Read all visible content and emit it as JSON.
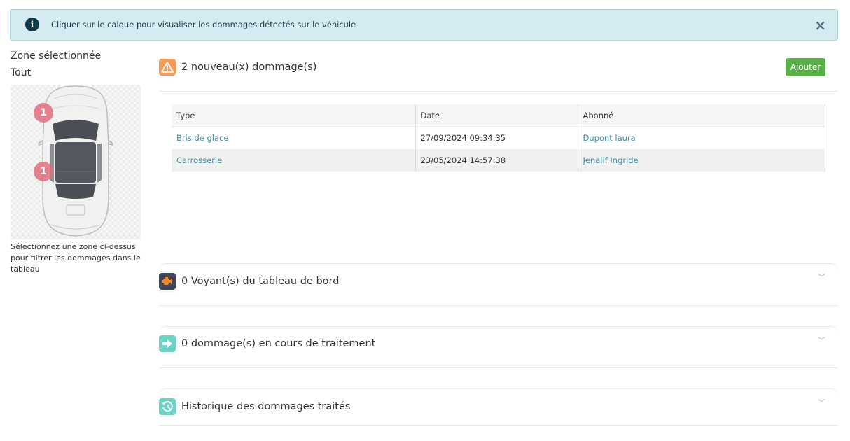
{
  "alert": {
    "message": "Cliquer sur le calque pour visualiser les dommages détectés sur le véhicule",
    "info_glyph": "i",
    "close_glyph": "×"
  },
  "sidebar": {
    "zone_title": "Zone sélectionnée",
    "zone_value": "Tout",
    "markers": [
      "1",
      "1"
    ],
    "hint": "Sélectionnez une zone ci-dessus pour filtrer les dommages dans le tableau"
  },
  "new_damages": {
    "title": "2 nouveau(x) dommage(s)",
    "add_label": "Ajouter",
    "columns": [
      "Type",
      "Date",
      "Abonné"
    ],
    "rows": [
      {
        "type": "Bris de glace",
        "date": "27/09/2024 09:34:35",
        "subscriber": "Dupont laura"
      },
      {
        "type": "Carrosserie",
        "date": "23/05/2024 14:57:38",
        "subscriber": "Jenalif Ingride"
      }
    ]
  },
  "sections": [
    {
      "title": "0 Voyant(s) du tableau de bord"
    },
    {
      "title": "0 dommage(s) en cours de traitement"
    },
    {
      "title": "Historique des dommages traités"
    }
  ],
  "colors": {
    "accent_link": "#3d8fa0",
    "add_button": "#5cae4c",
    "warning_icon": "#f49b5a",
    "teal_icon": "#6fd3c4",
    "alert_bg": "#d4ecf1"
  },
  "icons": {
    "alert": "info-icon",
    "close": "close-icon",
    "new": "warning-triangle-icon",
    "dashboard": "engine-light-icon",
    "in_progress": "arrow-right-icon",
    "history": "history-icon",
    "collapse": "chevron-down-icon"
  }
}
